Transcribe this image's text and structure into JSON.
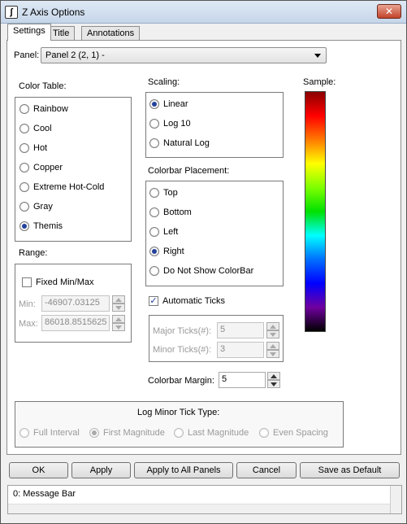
{
  "window": {
    "title": "Z Axis Options",
    "close_label": "✕",
    "icon_label": "ʃ"
  },
  "tabs": [
    "Settings",
    "Title",
    "Annotations"
  ],
  "panel": {
    "label": "Panel:",
    "value": "Panel 2 (2, 1)  -"
  },
  "color_table": {
    "label": "Color Table:",
    "options": [
      "Rainbow",
      "Cool",
      "Hot",
      "Copper",
      "Extreme Hot-Cold",
      "Gray",
      "Themis"
    ],
    "selected": "Themis"
  },
  "range": {
    "label": "Range:",
    "fixed_label": "Fixed Min/Max",
    "min_label": "Min:",
    "min_value": "-46907.03125",
    "max_label": "Max:",
    "max_value": "86018.8515625"
  },
  "scaling": {
    "label": "Scaling:",
    "options": [
      "Linear",
      "Log 10",
      "Natural Log"
    ],
    "selected": "Linear"
  },
  "colorbar_placement": {
    "label": "Colorbar Placement:",
    "options": [
      "Top",
      "Bottom",
      "Left",
      "Right",
      "Do Not Show ColorBar"
    ],
    "selected": "Right"
  },
  "ticks": {
    "automatic_label": "Automatic Ticks",
    "automatic_checked": true,
    "major_label": "Major Ticks(#):",
    "major_value": "5",
    "minor_label": "Minor Ticks(#):",
    "minor_value": "3"
  },
  "margin": {
    "label": "Colorbar Margin:",
    "value": "5"
  },
  "sample": {
    "label": "Sample:",
    "colors": [
      "#8a0000",
      "#ff0000",
      "#ff7a00",
      "#ffff00",
      "#7dff00",
      "#00e000",
      "#00ffff",
      "#0070ff",
      "#0000ff",
      "#7000a0",
      "#000000"
    ]
  },
  "log_minor": {
    "label": "Log Minor Tick Type:",
    "options": [
      "Full Interval",
      "First Magnitude",
      "Last Magnitude",
      "Even Spacing"
    ],
    "selected": "First Magnitude"
  },
  "buttons": {
    "ok": "OK",
    "apply": "Apply",
    "apply_all": "Apply to All Panels",
    "cancel": "Cancel",
    "save_default": "Save as Default"
  },
  "message_bar": {
    "text": "0: Message Bar"
  }
}
